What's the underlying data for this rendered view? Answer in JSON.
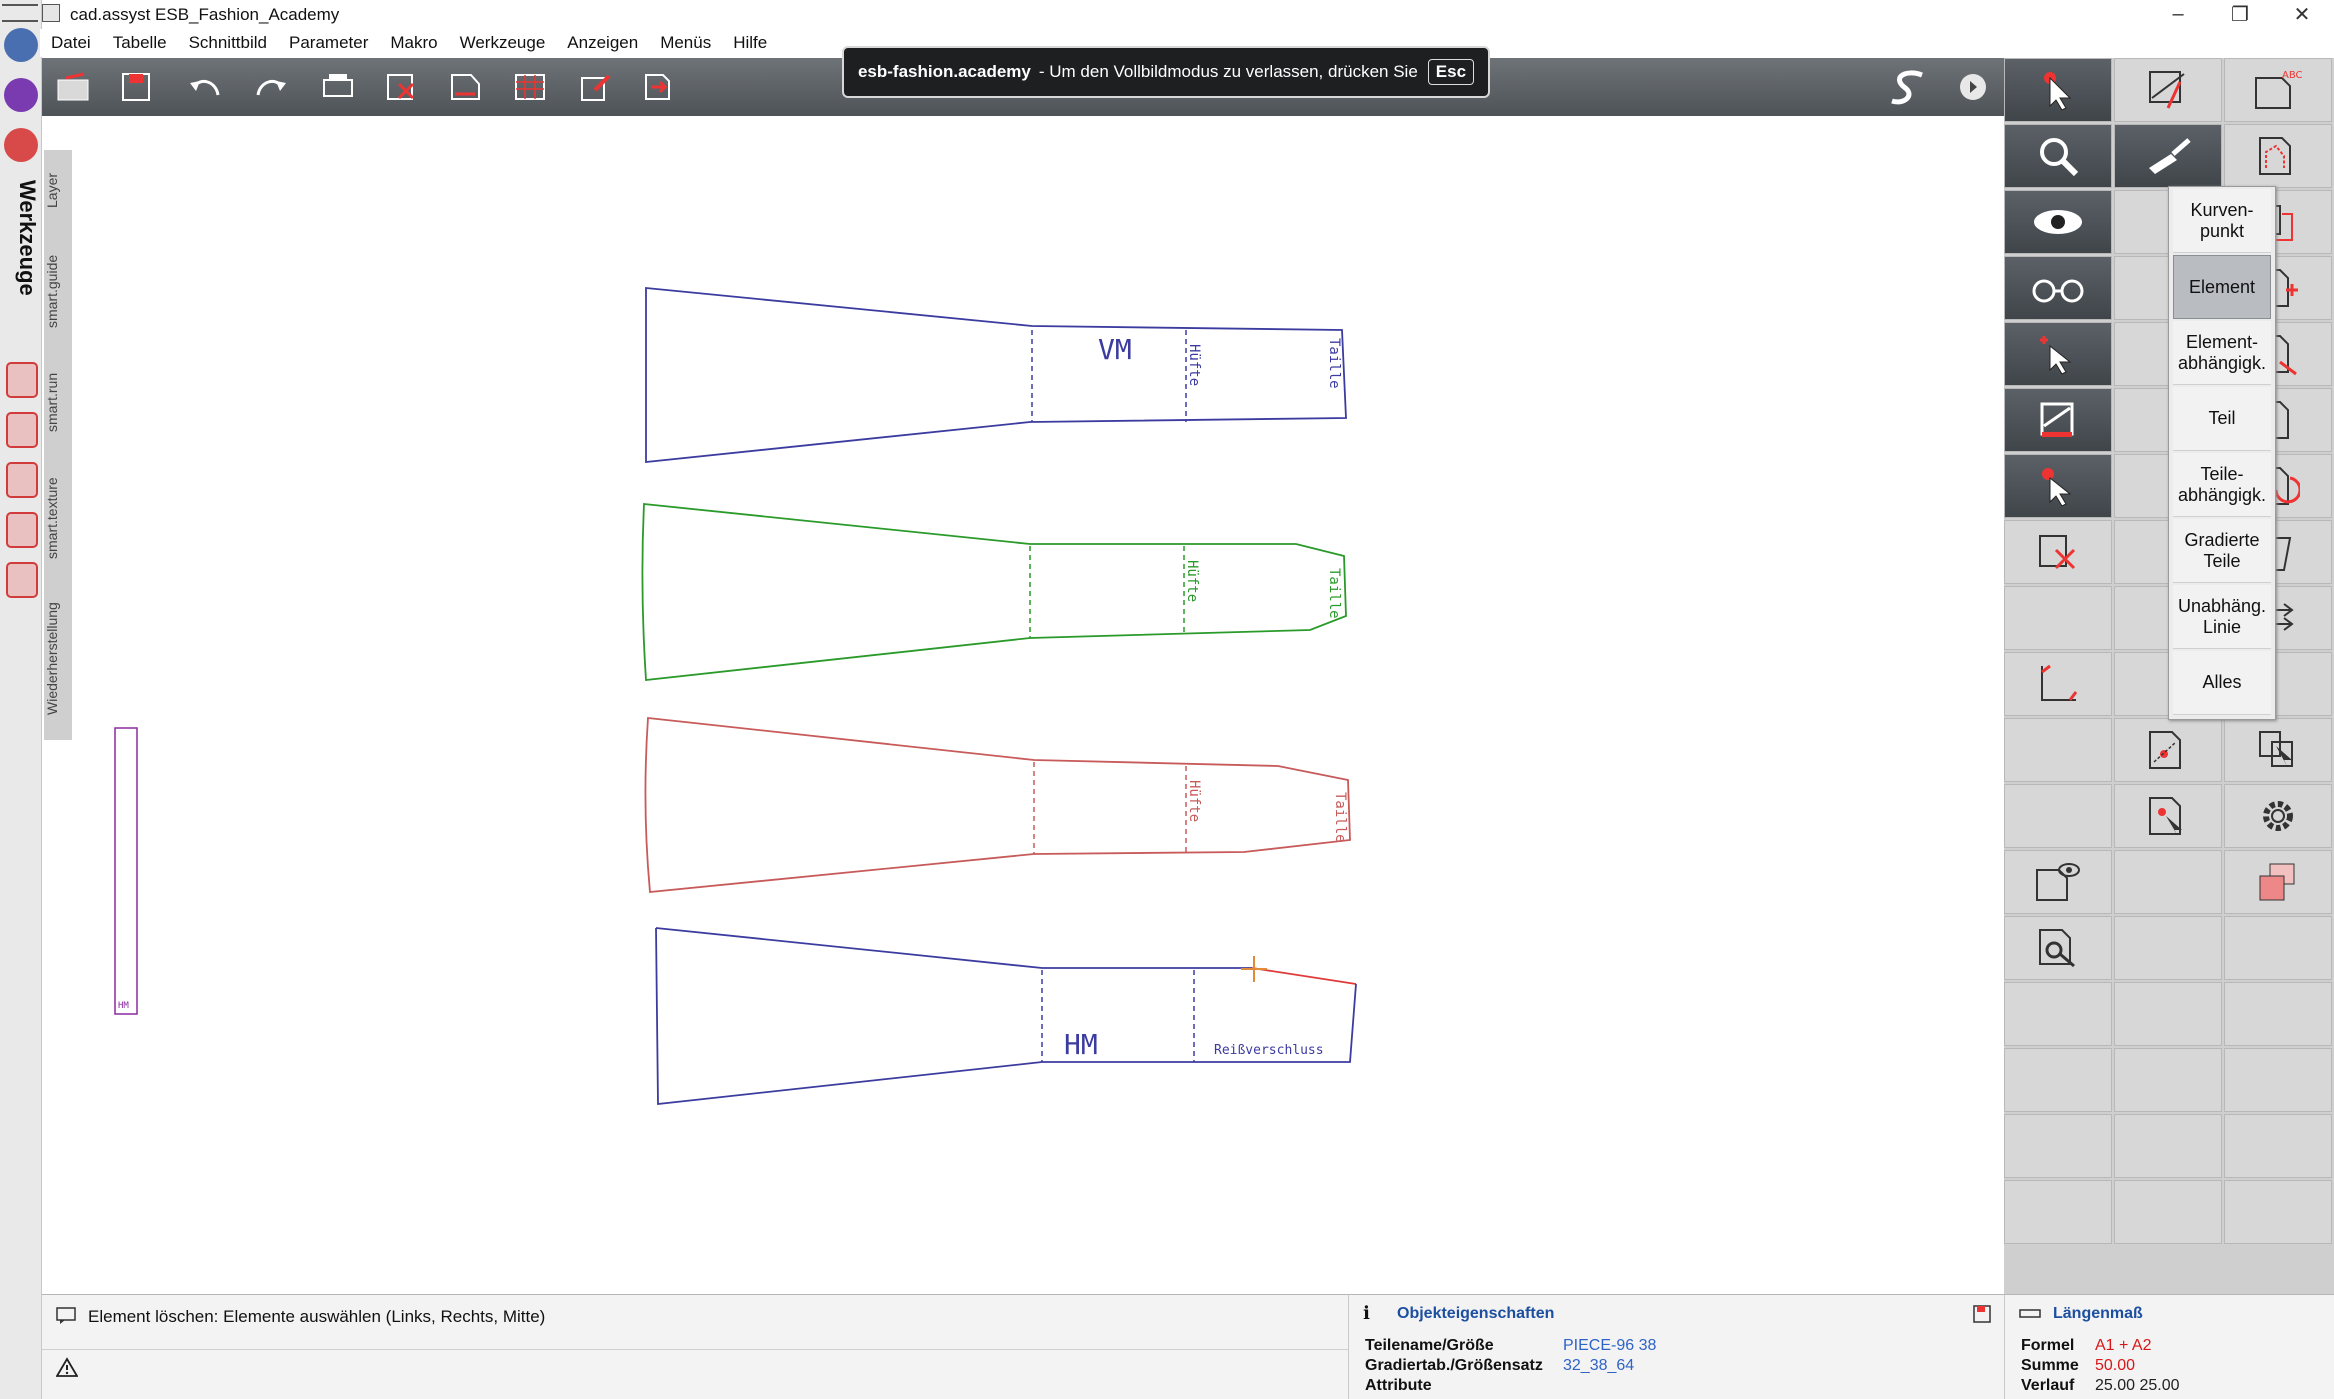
{
  "window": {
    "title": "cad.assyst  ESB_Fashion_Academy"
  },
  "menu": [
    "Datei",
    "Tabelle",
    "Schnittbild",
    "Parameter",
    "Makro",
    "Werkzeuge",
    "Anzeigen",
    "Menüs",
    "Hilfe"
  ],
  "banner": {
    "site": "esb-fashion.academy",
    "message": "-  Um den Vollbildmodus zu verlassen, drücken Sie",
    "key": "Esc"
  },
  "left_panel": {
    "title": "Werkzeuge",
    "tabs": [
      "Layer",
      "smart.guide",
      "smart.run",
      "smart.texture",
      "Wiederherstellung"
    ]
  },
  "canvas": {
    "pieces": [
      {
        "name": "VM",
        "color": "#3c3ca0",
        "labels": [
          "Hüfte",
          "Taille"
        ]
      },
      {
        "name": "",
        "color": "#2a9a2a",
        "labels": [
          "Hüfte",
          "Taille"
        ]
      },
      {
        "name": "",
        "color": "#c85a5a",
        "labels": [
          "Hüfte",
          "Taille"
        ]
      },
      {
        "name": "HM",
        "color": "#3c3ca0",
        "labels": [
          "Reißverschluss"
        ]
      }
    ],
    "side_piece_label": "HM"
  },
  "delete_menu": {
    "options": [
      "Kurven-\npunkt",
      "Element",
      "Element-\nabhängigk.",
      "Teil",
      "Teile-\nabhängigk.",
      "Gradierte\nTeile",
      "Unabhäng.\nLinie",
      "Alles"
    ],
    "selected": "Element"
  },
  "status": {
    "message": "Element löschen: Elemente auswählen (Links, Rechts, Mitte)"
  },
  "properties": {
    "title": "Objekteigenschaften",
    "rows": [
      {
        "label": "Teilename/Größe",
        "value": "PIECE-96 38"
      },
      {
        "label": "Gradiertab./Größensatz",
        "value": "32_38_64"
      },
      {
        "label": "Attribute",
        "value": ""
      }
    ]
  },
  "lengths": {
    "title": "Längenmaß",
    "rows": [
      {
        "label": "Formel",
        "value": "A1 + A2"
      },
      {
        "label": "Summe",
        "value": "50.00"
      },
      {
        "label": "Verlauf",
        "value": "25.00 25.00"
      }
    ]
  }
}
